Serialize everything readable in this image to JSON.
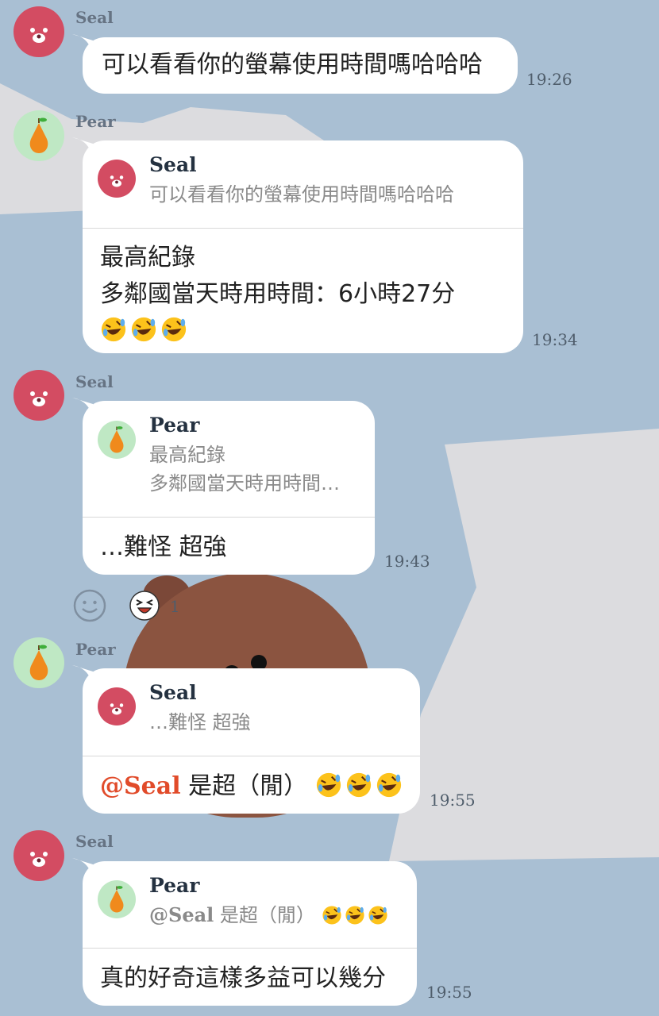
{
  "messages": [
    {
      "sender": "Seal",
      "text": "可以看看你的螢幕使用時間嗎哈哈哈",
      "time": "19:26"
    },
    {
      "sender": "Pear",
      "quote": {
        "name": "Seal",
        "text": "可以看看你的螢幕使用時間嗎哈哈哈"
      },
      "lines": [
        "最高紀錄",
        "多鄰國當天時用時間：6小時27分"
      ],
      "time": "19:34"
    },
    {
      "sender": "Seal",
      "quote": {
        "name": "Pear",
        "lines": [
          "最高紀錄",
          "多鄰國當天時用時間…"
        ]
      },
      "text": "…難怪 超強",
      "time": "19:43"
    },
    {
      "sender": "Pear",
      "quote": {
        "name": "Seal",
        "text": "…難怪 超強"
      },
      "mention": "@Seal",
      "text": "是超（閒）",
      "time": "19:55"
    },
    {
      "sender": "Seal",
      "quote": {
        "name": "Pear",
        "mention": "@Seal",
        "text": "是超（閒）"
      },
      "text": "真的好奇這樣多益可以幾分",
      "time": "19:55"
    }
  ],
  "reaction": {
    "icon": "laughing-face-icon",
    "count": "1"
  },
  "emoji": "rolling-on-floor-laughing-icon",
  "colors": {
    "background": "#a9bfd3",
    "seal_avatar": "#d34c62",
    "pear_avatar": "#bfe8c4",
    "mention": "#e14b2a"
  }
}
